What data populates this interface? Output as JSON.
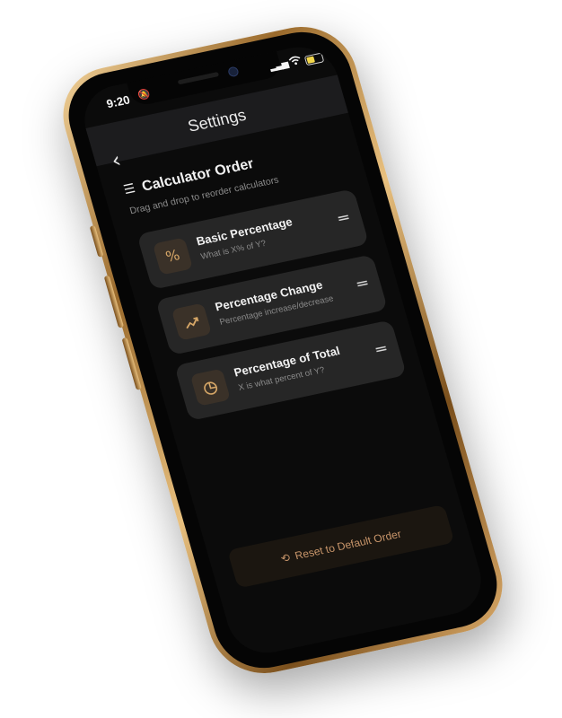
{
  "status_bar": {
    "time": "9:20",
    "bell_icon": "bell-slash-icon",
    "signal_icon": "cellular-signal-icon",
    "wifi_icon": "wifi-icon",
    "battery_color": "#f2d64b"
  },
  "header": {
    "title": "Settings"
  },
  "nav": {
    "back_icon": "chevron-left-icon"
  },
  "section": {
    "icon": "list-lines-icon",
    "title": "Calculator Order",
    "subtitle": "Drag and drop to reorder calculators"
  },
  "calculators": [
    {
      "icon": "percent-icon",
      "title": "Basic Percentage",
      "description": "What is X% of Y?"
    },
    {
      "icon": "trend-up-icon",
      "title": "Percentage Change",
      "description": "Percentage increase/decrease"
    },
    {
      "icon": "pie-chart-icon",
      "title": "Percentage of Total",
      "description": "X is what percent of Y?"
    }
  ],
  "reset_button": {
    "icon": "history-icon",
    "label": "Reset to Default Order",
    "accent_color": "#c8956a"
  },
  "colors": {
    "frame_gold": "#d9a968",
    "screen_bg": "#0b0b0b",
    "card_bg": "#262626",
    "icon_accent": "#d7a767"
  }
}
